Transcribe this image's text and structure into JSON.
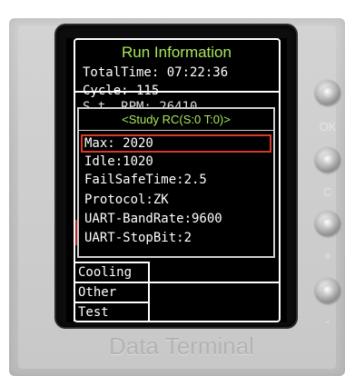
{
  "screen": {
    "title": "Run Information",
    "info_lines": [
      "TotalTime: 07:22:36",
      "Cycle: 115",
      "S  t. RPM: 26410"
    ]
  },
  "popup": {
    "title": "<Study RC(S:0 T:0)>",
    "items": [
      "Max: 2020",
      "Idle:1020",
      "FailSafeTime:2.5",
      "Protocol:ZK",
      "UART-BandRate:9600",
      "UART-StopBit:2"
    ],
    "selected_index": 0
  },
  "menu": {
    "items": [
      "Cooling",
      "Other",
      "Test"
    ]
  },
  "buttons": {
    "labels": [
      "OK",
      "C",
      "+",
      "-"
    ]
  },
  "brand": "Data Terminal",
  "colors": {
    "title_green": "#a8e65a",
    "selection_red": "#d9382d",
    "screen_bg": "#000000",
    "enclosure": "#c8c8c8"
  }
}
